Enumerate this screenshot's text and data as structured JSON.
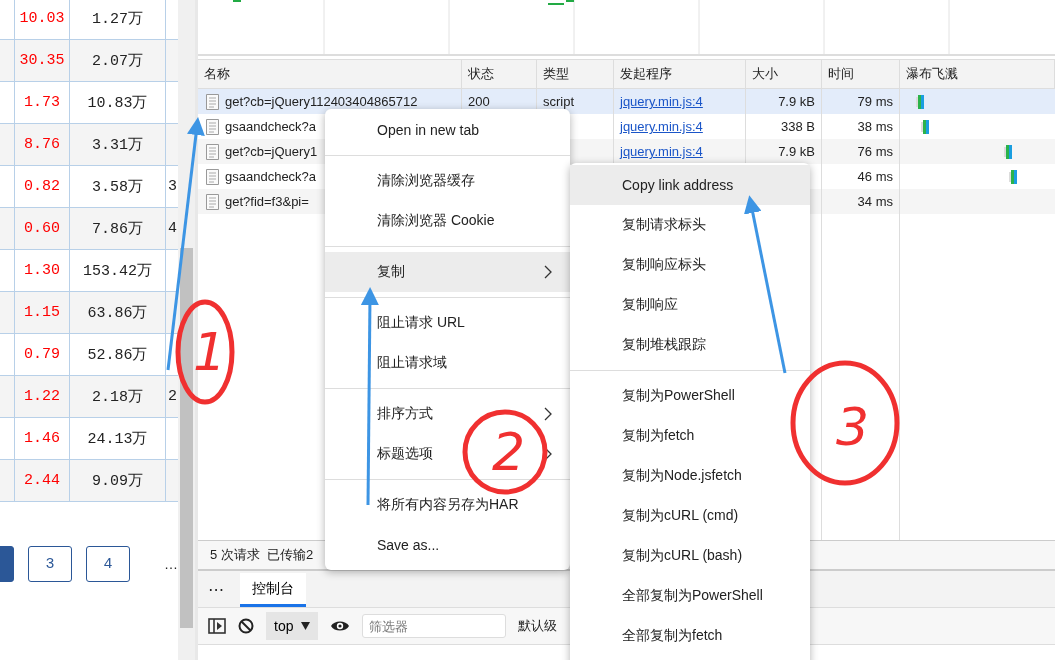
{
  "left_table": {
    "rows": [
      {
        "change": "10.03",
        "volume": "1.27万"
      },
      {
        "change": "30.35",
        "volume": "2.07万"
      },
      {
        "change": "1.73",
        "volume": "10.83万"
      },
      {
        "change": "8.76",
        "volume": "3.31万"
      },
      {
        "change": "0.82",
        "volume": "3.58万",
        "column_4": "3"
      },
      {
        "change": "0.60",
        "volume": "7.86万",
        "column_4": "4"
      },
      {
        "change": "1.30",
        "volume": "153.42万"
      },
      {
        "change": "1.15",
        "volume": "63.86万"
      },
      {
        "change": "0.79",
        "volume": "52.86万"
      },
      {
        "change": "1.22",
        "volume": "2.18万",
        "column_4": "2"
      },
      {
        "change": "1.46",
        "volume": "24.13万"
      },
      {
        "change": "2.44",
        "volume": "9.09万"
      }
    ]
  },
  "pagination": {
    "pages": [
      {
        "selected": true
      },
      {
        "label": "3",
        "selected": false
      },
      {
        "label": "4",
        "selected": false
      }
    ],
    "more": "…"
  },
  "network": {
    "columns": [
      "名称",
      "状态",
      "类型",
      "发起程序",
      "大小",
      "时间",
      "瀑布飞溅"
    ],
    "rows": [
      {
        "name": "get?cb=jQuery112403404865712",
        "status": "200",
        "type": "script",
        "initiator": "jquery.min.js:4",
        "size": "7.9 kB",
        "time": "79 ms",
        "selected": true
      },
      {
        "name": "gsaandcheck?a",
        "initiator": "jquery.min.js:4",
        "size": "338 B",
        "time": "38 ms",
        "selected": false
      },
      {
        "name": "get?cb=jQuery1",
        "initiator": "jquery.min.js:4",
        "size": "7.9 kB",
        "time": "76 ms",
        "selected": false
      },
      {
        "name": "gsaandcheck?a",
        "time": "46 ms",
        "selected": false
      },
      {
        "name": "get?fid=f3&pi=",
        "time": "34 ms",
        "selected": false
      }
    ]
  },
  "status_bar": "5 次请求  已传输2",
  "drawer": {
    "more": "⋯",
    "tabs": [
      {
        "label": "控制台",
        "selected": true
      }
    ]
  },
  "console_toolbar": {
    "context": "top",
    "filter_placeholder": "筛选器",
    "levels": "默认级"
  },
  "context_menu": {
    "items": [
      {
        "kind": "item",
        "label": "Open in new tab",
        "highlighted": false
      },
      {
        "kind": "separator"
      },
      {
        "kind": "item",
        "label": "清除浏览器缓存",
        "highlighted": false
      },
      {
        "kind": "item",
        "label": "清除浏览器 Cookie",
        "highlighted": false
      },
      {
        "kind": "separator"
      },
      {
        "kind": "item",
        "label": "复制",
        "highlighted": true,
        "has_submenu": true
      },
      {
        "kind": "separator"
      },
      {
        "kind": "item",
        "label": "阻止请求 URL",
        "highlighted": false
      },
      {
        "kind": "item",
        "label": "阻止请求域",
        "highlighted": false
      },
      {
        "kind": "separator"
      },
      {
        "kind": "item",
        "label": "排序方式",
        "highlighted": false,
        "has_submenu": true
      },
      {
        "kind": "item",
        "label": "标题选项",
        "highlighted": false,
        "has_submenu": true
      },
      {
        "kind": "separator"
      },
      {
        "kind": "item",
        "label": "将所有内容另存为HAR",
        "highlighted": false
      },
      {
        "kind": "item",
        "label": "Save as...",
        "highlighted": false
      }
    ]
  },
  "submenu": {
    "items": [
      {
        "kind": "item",
        "label": "Copy link address",
        "highlighted": true
      },
      {
        "kind": "item",
        "label": "复制请求标头",
        "highlighted": false
      },
      {
        "kind": "item",
        "label": "复制响应标头",
        "highlighted": false
      },
      {
        "kind": "item",
        "label": "复制响应",
        "highlighted": false
      },
      {
        "kind": "item",
        "label": "复制堆栈跟踪",
        "highlighted": false
      },
      {
        "kind": "separator"
      },
      {
        "kind": "item",
        "label": "复制为PowerShell",
        "highlighted": false
      },
      {
        "kind": "item",
        "label": "复制为fetch",
        "highlighted": false
      },
      {
        "kind": "item",
        "label": "复制为Node.jsfetch",
        "highlighted": false
      },
      {
        "kind": "item",
        "label": "复制为cURL (cmd)",
        "highlighted": false
      },
      {
        "kind": "item",
        "label": "复制为cURL (bash)",
        "highlighted": false
      },
      {
        "kind": "item",
        "label": "全部复制为PowerShell",
        "highlighted": false
      },
      {
        "kind": "item",
        "label": "全部复制为fetch",
        "highlighted": false
      }
    ]
  },
  "annotations": [
    {
      "label": "1"
    },
    {
      "label": "2"
    },
    {
      "label": "3"
    }
  ]
}
